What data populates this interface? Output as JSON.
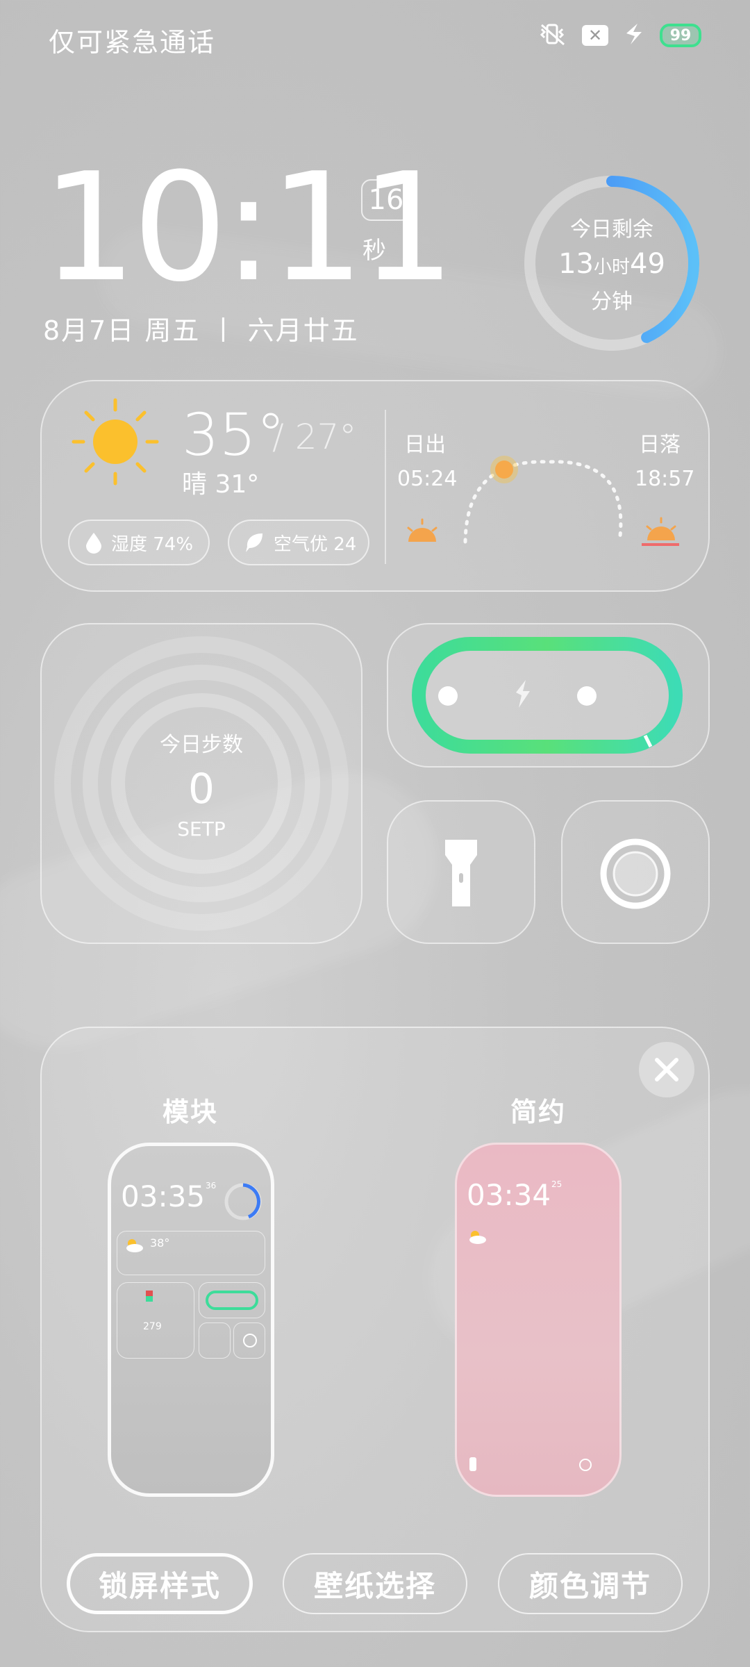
{
  "status": {
    "left_text": "仅可紧急通话",
    "icons": [
      "vibrate-off-icon",
      "signal-x-icon",
      "charging-bolt-icon",
      "battery-icon"
    ],
    "x_glyph": "✕",
    "battery_percent": "99"
  },
  "clock": {
    "time": "10:11",
    "seconds": "16",
    "seconds_label": "秒",
    "date": "8月7日 周五 丨 六月廿五"
  },
  "remaining": {
    "title": "今日剩余",
    "hours": "13",
    "hours_unit": "小时",
    "minutes": "49",
    "minutes_unit": "分钟",
    "progress": 0.43
  },
  "weather": {
    "temp": "35°",
    "low": "/ 27°",
    "condition": "晴 31°",
    "humidity": "湿度 74%",
    "air": "空气优 24",
    "sunrise_label": "日出",
    "sunrise_time": "05:24",
    "sunset_label": "日落",
    "sunset_time": "18:57"
  },
  "steps": {
    "title": "今日步数",
    "value": "0",
    "unit": "SETP"
  },
  "panel": {
    "styles": [
      {
        "label": "模块",
        "time": "03:35",
        "seconds": "36",
        "temp": "38°",
        "steps": "279"
      },
      {
        "label": "简约",
        "time": "03:34",
        "seconds": "25"
      }
    ],
    "buttons": [
      "锁屏样式",
      "壁纸选择",
      "颜色调节"
    ],
    "selected_button": "锁屏样式"
  },
  "colors": {
    "accent_blue": "#3c7bf5",
    "charge_green": "#3ddc9a",
    "sun_yellow": "#fbc02d",
    "sun_orange": "#f4a44c",
    "simple_pink": "#e8bec6"
  }
}
